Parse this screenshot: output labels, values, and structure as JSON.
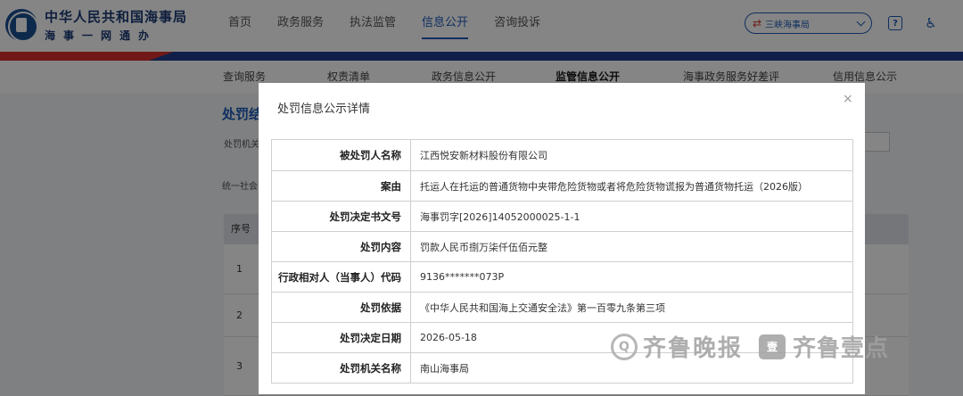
{
  "header": {
    "org_name": "中华人民共和国海事局",
    "org_sub": "海事一网通办",
    "nav": [
      "首页",
      "政务服务",
      "执法监管",
      "信息公开",
      "咨询投诉"
    ],
    "active_nav": "信息公开",
    "site_select": "三峡海事局",
    "help_icon": "?",
    "accessibility_icon": "♿"
  },
  "subnav": {
    "items": [
      "查询服务",
      "权责清单",
      "政务信息公开",
      "监管信息公开",
      "海事政务服务好差评",
      "信用信息公示"
    ],
    "active": "监管信息公开"
  },
  "background_page": {
    "title": "处罚结",
    "filter_label": "处罚机关",
    "filter_label2": "统一社会",
    "table_header": "序号",
    "rows": [
      "1",
      "2",
      "3"
    ]
  },
  "modal": {
    "title": "处罚信息公示详情",
    "close_label": "×",
    "rows": [
      {
        "label": "被处罚人名称",
        "value": "江西悦安新材料股份有限公司"
      },
      {
        "label": "案由",
        "value": "托运人在托运的普通货物中夹带危险货物或者将危险货物谎报为普通货物托运（2026版）"
      },
      {
        "label": "处罚决定书文号",
        "value": "海事罚字[2026]14052000025-1-1"
      },
      {
        "label": "处罚内容",
        "value": "罚款人民币捌万柒仟伍佰元整"
      },
      {
        "label": "行政相对人（当事人）代码",
        "value": "9136*******073P"
      },
      {
        "label": "处罚依据",
        "value": "《中华人民共和国海上交通安全法》第一百零九条第三项"
      },
      {
        "label": "处罚决定日期",
        "value": "2026-05-18"
      },
      {
        "label": "处罚机关名称",
        "value": "南山海事局"
      }
    ]
  },
  "watermark": {
    "brand1": "齐鲁晚报",
    "brand2": "齐鲁壹点",
    "logo_char": "壹"
  }
}
